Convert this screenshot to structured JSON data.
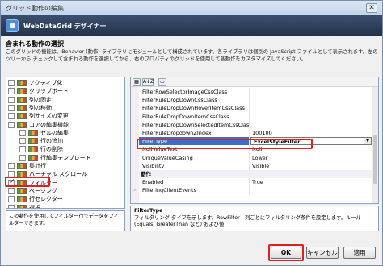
{
  "window": {
    "title": "グリッド動作の編集",
    "close_glyph": "✕"
  },
  "header": {
    "title": "WebDataGrid デザイナー"
  },
  "section": {
    "title": "含まれる動作の選択",
    "description": "このグリッドの機能は、Behavior (動作) ライブラリにモジュールとして構成されています。各ライブラリは個別の JavaScript ファイルとして表示されます。左のツリーから チェックして含まれる動作を選択してから、右のプロパティのグリッドを使用して各動作をカスタマイズしてください。"
  },
  "behaviors": [
    {
      "label": "アクティブ化",
      "checked": false,
      "indent": 0
    },
    {
      "label": "クリップボード",
      "checked": false,
      "indent": 0
    },
    {
      "label": "列の固定",
      "checked": false,
      "indent": 0
    },
    {
      "label": "列の移動",
      "checked": false,
      "indent": 0
    },
    {
      "label": "列サイズの変更",
      "checked": false,
      "indent": 0
    },
    {
      "label": "コアの編集機能",
      "checked": false,
      "indent": 0
    },
    {
      "label": "セルの編集",
      "checked": false,
      "indent": 1
    },
    {
      "label": "行の追加",
      "checked": false,
      "indent": 1
    },
    {
      "label": "行の削除",
      "checked": false,
      "indent": 1
    },
    {
      "label": "行編集テンプレート",
      "checked": false,
      "indent": 1
    },
    {
      "label": "集計行",
      "checked": false,
      "indent": 0
    },
    {
      "label": "バーチャル スクロール",
      "checked": false,
      "indent": 0
    },
    {
      "label": "フィルター",
      "checked": true,
      "indent": 0
    },
    {
      "label": "ページング",
      "checked": false,
      "indent": 0
    },
    {
      "label": "行セレクター",
      "checked": false,
      "indent": 0
    },
    {
      "label": "選択",
      "checked": false,
      "indent": 0
    }
  ],
  "behavior_description": "この動作を使用してフィルター行でデータをフィルターできます。",
  "toolbar": {
    "categorized_glyph": "▦",
    "alpha_glyph": "A↓Z",
    "pages_glyph": "▭"
  },
  "properties": [
    {
      "name": "FilterRowSelectorImageCssClass",
      "value": ""
    },
    {
      "name": "FilterRuleDropDownCssClass",
      "value": ""
    },
    {
      "name": "FilterRuleDropDownHoverItemCssClass",
      "value": ""
    },
    {
      "name": "FilterRuleDropDownItemCssClass",
      "value": ""
    },
    {
      "name": "FilterRuleDropDownSelectedItemCssClass",
      "value": ""
    },
    {
      "name": "FilterRuleDropdownZIndex",
      "value": "100100"
    },
    {
      "name": "FilterType",
      "value": "ExcelStyleFilter",
      "selected": true
    },
    {
      "name": "NullValueText",
      "value": "Null"
    },
    {
      "name": "UniqueValueCasing",
      "value": "Lower"
    },
    {
      "name": "Visibility",
      "value": "Visible"
    },
    {
      "name": "動作",
      "value": "",
      "category": true
    },
    {
      "name": "Enabled",
      "value": "True"
    },
    {
      "name": "FilteringClientEvents",
      "value": "",
      "expandable": true
    }
  ],
  "help": {
    "title": "FilterType",
    "text": "フィルタリング タイプを示します。RowFilter - 列ごとにフィルタリング条件を設定します。ルール (Equals, GreaterThan など) および値"
  },
  "buttons": {
    "ok": "OK",
    "cancel": "キャンセル",
    "apply": "適用"
  },
  "colors": {
    "header_bg": "#2c3d57",
    "selection": "#3a6fc4",
    "highlight": "#e02020"
  }
}
